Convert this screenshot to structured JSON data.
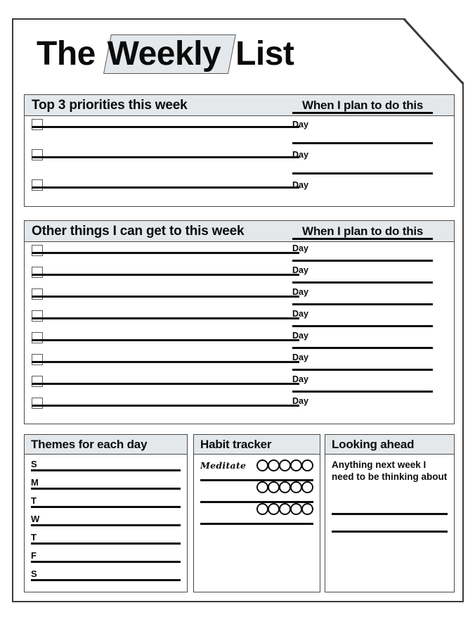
{
  "document": {
    "title_part1": "The ",
    "title_highlight": "Weekly",
    "title_part2": " List"
  },
  "priorities": {
    "heading": "Top 3 priorities this week",
    "when_heading": "When I plan to do this",
    "day_label": "Day",
    "row_count": 3
  },
  "other_things": {
    "heading": "Other things I can get to this week",
    "when_heading": "When I plan to do this",
    "day_label": "Day",
    "row_count": 8
  },
  "themes": {
    "heading": "Themes for each day",
    "days": [
      "S",
      "M",
      "T",
      "W",
      "T",
      "F",
      "S"
    ]
  },
  "habits": {
    "heading": "Habit tracker",
    "sample_entry": "Meditate",
    "circles_per_row": 5,
    "row_count": 3
  },
  "looking_ahead": {
    "heading": "Looking ahead",
    "prompt": "Anything next week I need to be thinking about",
    "line_count": 2
  },
  "colors": {
    "header_band": "#e5e8eb",
    "ink": "#0d0d0d",
    "border": "#4a4a4a"
  }
}
